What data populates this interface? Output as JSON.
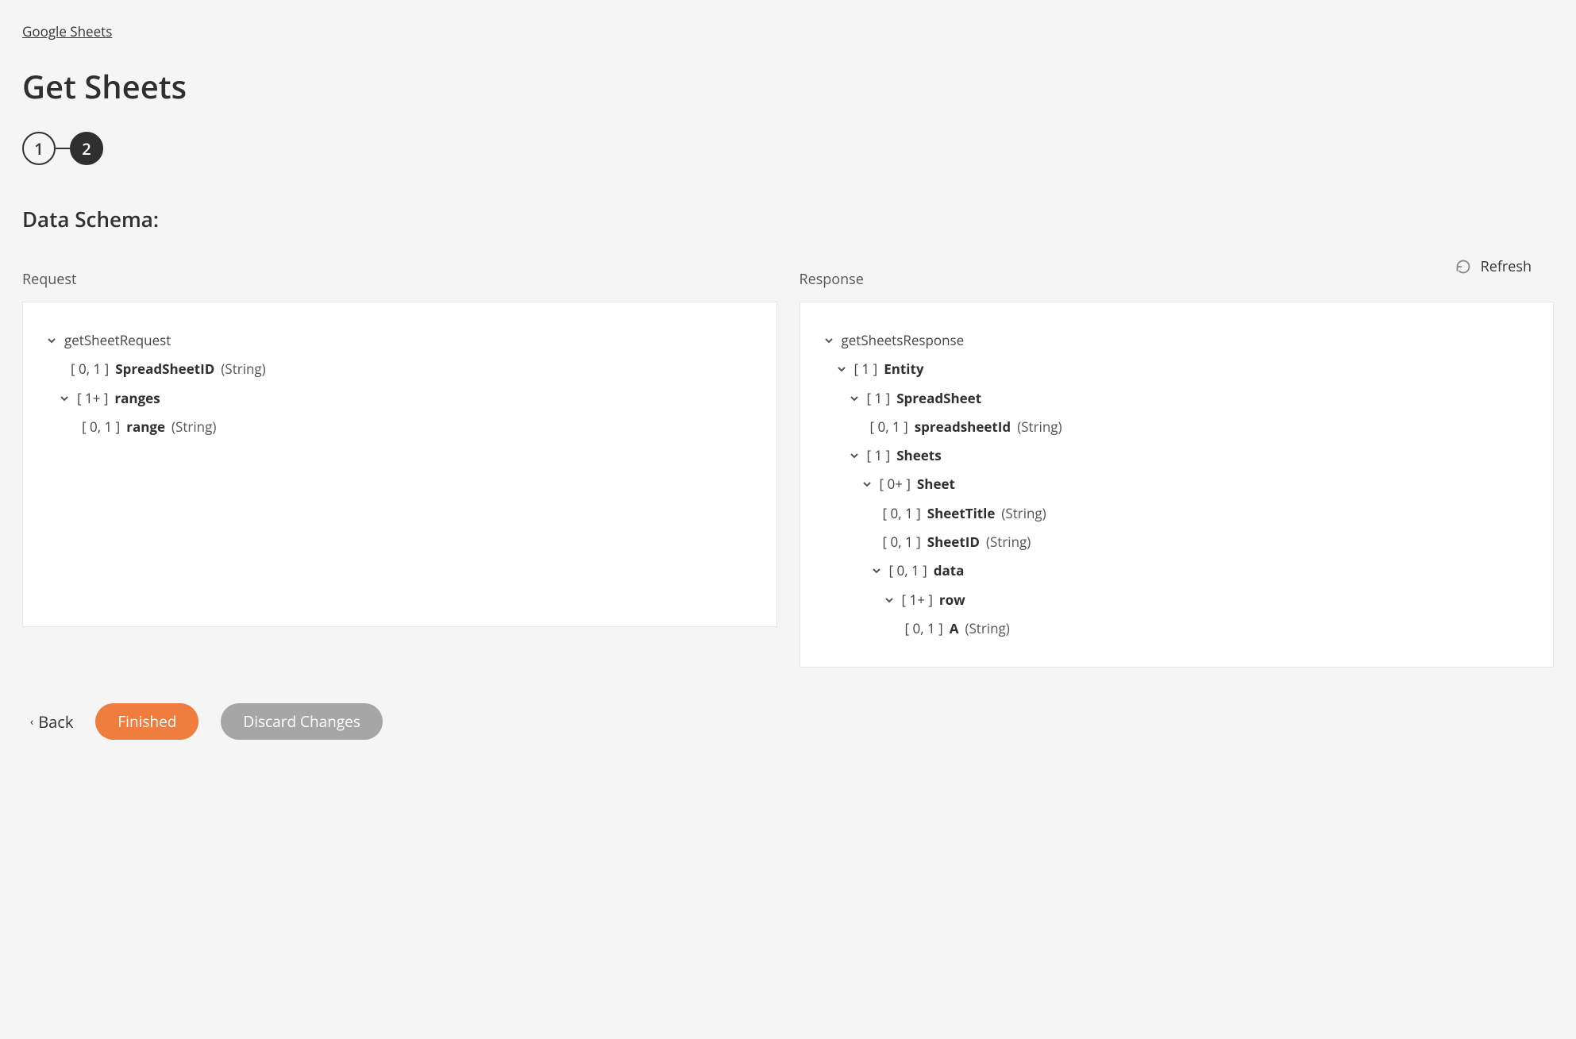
{
  "breadcrumb": "Google Sheets",
  "title": "Get Sheets",
  "steps": {
    "s1": "1",
    "s2": "2"
  },
  "section": "Data Schema:",
  "refresh": "Refresh",
  "request_label": "Request",
  "response_label": "Response",
  "request_tree": {
    "root": "getSheetRequest",
    "spreadsheet_card": "[ 0, 1 ]",
    "spreadsheet_name": "SpreadSheetID",
    "spreadsheet_type": "(String)",
    "ranges_card": "[ 1+ ]",
    "ranges_name": "ranges",
    "range_card": "[ 0, 1 ]",
    "range_name": "range",
    "range_type": "(String)"
  },
  "response_tree": {
    "root": "getSheetsResponse",
    "entity_card": "[ 1 ]",
    "entity_name": "Entity",
    "ss_card": "[ 1 ]",
    "ss_name": "SpreadSheet",
    "ssid_card": "[ 0, 1 ]",
    "ssid_name": "spreadsheetId",
    "ssid_type": "(String)",
    "sheets_card": "[ 1 ]",
    "sheets_name": "Sheets",
    "sheet_card": "[ 0+ ]",
    "sheet_name": "Sheet",
    "stitle_card": "[ 0, 1 ]",
    "stitle_name": "SheetTitle",
    "stitle_type": "(String)",
    "sid_card": "[ 0, 1 ]",
    "sid_name": "SheetID",
    "sid_type": "(String)",
    "data_card": "[ 0, 1 ]",
    "data_name": "data",
    "row_card": "[ 1+ ]",
    "row_name": "row",
    "a_card": "[ 0, 1 ]",
    "a_name": "A",
    "a_type": "(String)"
  },
  "footer": {
    "back": "Back",
    "finished": "Finished",
    "discard": "Discard Changes"
  }
}
